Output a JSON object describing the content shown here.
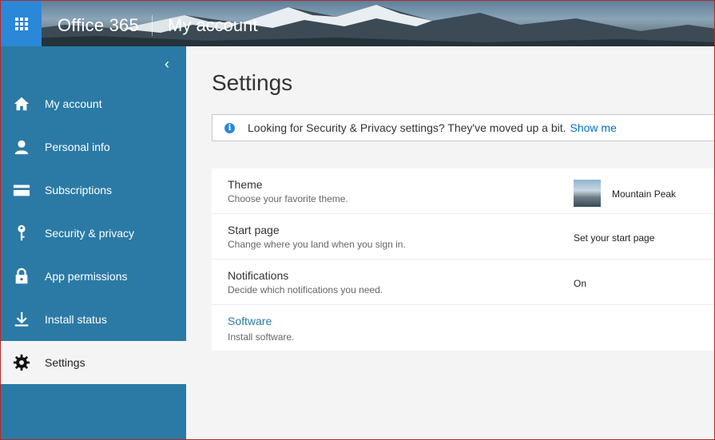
{
  "header": {
    "brand": "Office 365",
    "app_name": "My account"
  },
  "sidebar": {
    "collapse_icon": "chevron-left-icon",
    "items": [
      {
        "label": "My account",
        "icon": "home-icon"
      },
      {
        "label": "Personal info",
        "icon": "person-icon"
      },
      {
        "label": "Subscriptions",
        "icon": "card-icon"
      },
      {
        "label": "Security & privacy",
        "icon": "key-icon"
      },
      {
        "label": "App permissions",
        "icon": "lock-icon"
      },
      {
        "label": "Install status",
        "icon": "download-icon"
      },
      {
        "label": "Settings",
        "icon": "gear-icon",
        "active": true
      }
    ]
  },
  "main": {
    "title": "Settings",
    "notice": {
      "text": "Looking for Security & Privacy settings? They've moved up a bit.",
      "link": "Show me"
    },
    "settings": [
      {
        "title": "Theme",
        "desc": "Choose your favorite theme.",
        "value": "Mountain Peak"
      },
      {
        "title": "Start page",
        "desc": "Change where you land when you sign in.",
        "value": "Set your start page"
      },
      {
        "title": "Notifications",
        "desc": "Decide which notifications you need.",
        "value": "On"
      },
      {
        "title": "Software",
        "desc": "Install software.",
        "value": ""
      }
    ]
  },
  "colors": {
    "sidebar": "#2b7aa5",
    "waffle": "#2b88d8",
    "link": "#0072c6",
    "background": "#f4f4f4"
  }
}
